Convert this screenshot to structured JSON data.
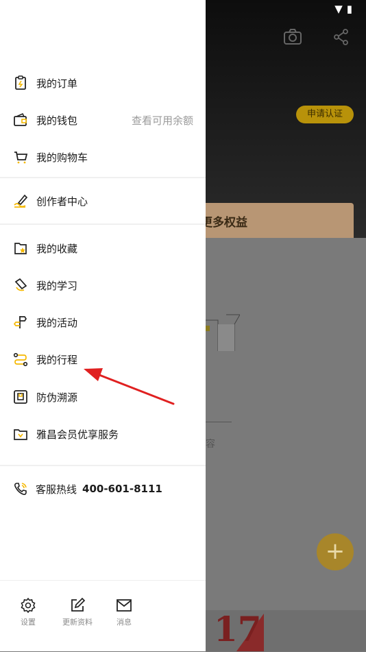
{
  "background": {
    "apply_label": "申请认证",
    "promo_text": "更多权益",
    "empty_text": "容",
    "fab_symbol": "+",
    "sticker_text": "17"
  },
  "menu": {
    "group1": [
      {
        "label": "我的订单",
        "icon": "order-icon"
      },
      {
        "label": "我的钱包",
        "icon": "wallet-icon",
        "hint": "查看可用余额"
      },
      {
        "label": "我的购物车",
        "icon": "cart-icon"
      }
    ],
    "group2": [
      {
        "label": "创作者中心",
        "icon": "creator-icon"
      }
    ],
    "group3": [
      {
        "label": "我的收藏",
        "icon": "favorites-icon"
      },
      {
        "label": "我的学习",
        "icon": "study-icon"
      },
      {
        "label": "我的活动",
        "icon": "activity-icon"
      },
      {
        "label": "我的行程",
        "icon": "itinerary-icon"
      },
      {
        "label": "防伪溯源",
        "icon": "anti-counterfeit-icon"
      },
      {
        "label": "雅昌会员优享服务",
        "icon": "membership-icon"
      }
    ],
    "hotline": {
      "label": "客服热线",
      "number": "400-601-8111",
      "icon": "phone-icon"
    }
  },
  "bottom_bar": [
    {
      "label": "设置",
      "icon": "gear-icon"
    },
    {
      "label": "更新资料",
      "icon": "edit-icon"
    },
    {
      "label": "消息",
      "icon": "mail-icon"
    }
  ],
  "colors": {
    "accent": "#f5b800",
    "annotation": "#e02020"
  }
}
